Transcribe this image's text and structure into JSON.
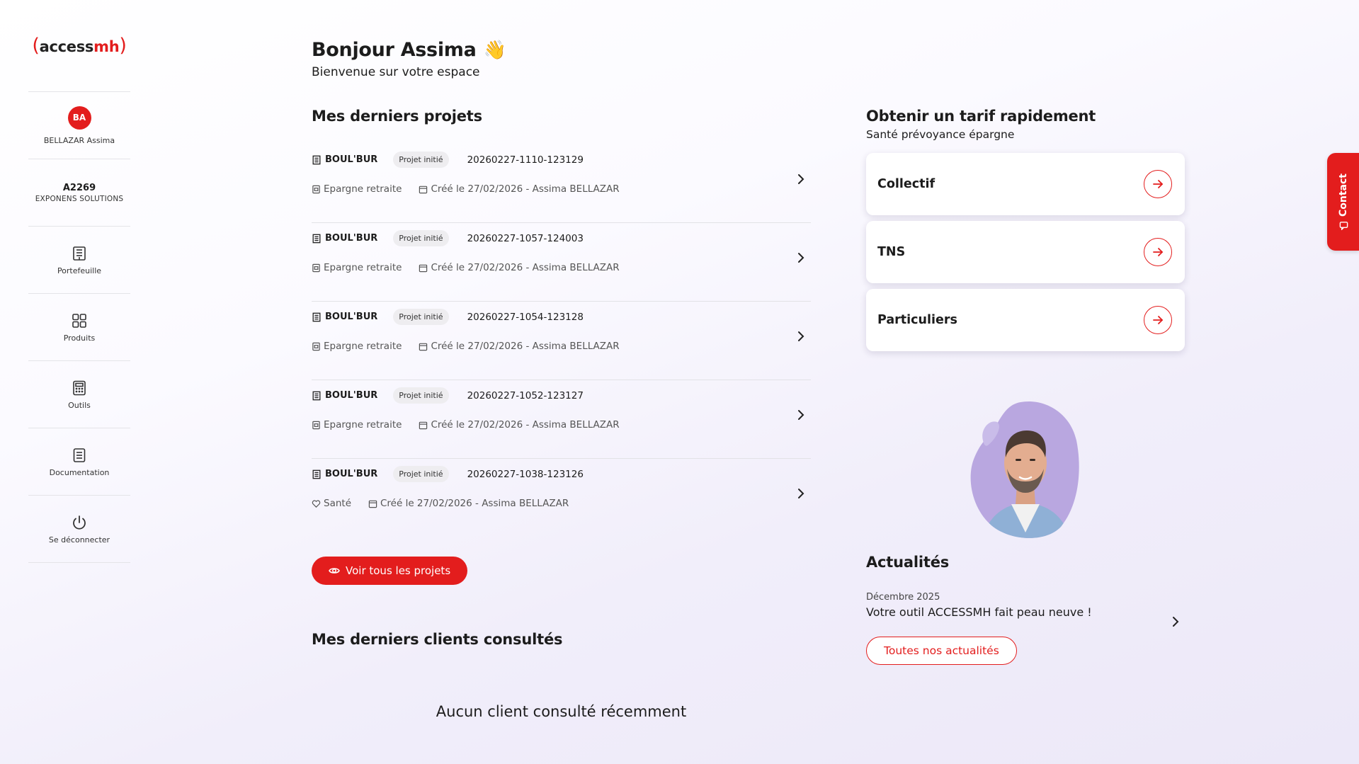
{
  "brand": {
    "logo_prefix": "(",
    "logo_main": "access",
    "logo_accent": "mh",
    "logo_suffix": ")",
    "accent_color": "#e31d1d"
  },
  "sidebar": {
    "user": {
      "initials": "BA",
      "name": "BELLAZAR Assima"
    },
    "agency": {
      "code": "A2269",
      "name": "EXPONENS SOLUTIONS"
    },
    "items": [
      {
        "label": "Portefeuille",
        "icon": "building-icon"
      },
      {
        "label": "Produits",
        "icon": "grid-icon"
      },
      {
        "label": "Outils",
        "icon": "calculator-icon"
      },
      {
        "label": "Documentation",
        "icon": "document-icon"
      },
      {
        "label": "Se déconnecter",
        "icon": "power-icon"
      }
    ]
  },
  "header": {
    "title": "Bonjour Assima",
    "subtitle": "Bienvenue sur votre espace",
    "emoji": "👋"
  },
  "projects": {
    "title": "Mes derniers projets",
    "items": [
      {
        "company": "BOUL'BUR",
        "status": "Projet initié",
        "ref": "20260227-1110-123129",
        "category": "Epargne retraite",
        "created": "Créé le 27/02/2026 - Assima BELLAZAR"
      },
      {
        "company": "BOUL'BUR",
        "status": "Projet initié",
        "ref": "20260227-1057-124003",
        "category": "Epargne retraite",
        "created": "Créé le 27/02/2026 - Assima BELLAZAR"
      },
      {
        "company": "BOUL'BUR",
        "status": "Projet initié",
        "ref": "20260227-1054-123128",
        "category": "Epargne retraite",
        "created": "Créé le 27/02/2026 - Assima BELLAZAR"
      },
      {
        "company": "BOUL'BUR",
        "status": "Projet initié",
        "ref": "20260227-1052-123127",
        "category": "Epargne retraite",
        "created": "Créé le 27/02/2026 - Assima BELLAZAR"
      },
      {
        "company": "BOUL'BUR",
        "status": "Projet initié",
        "ref": "20260227-1038-123126",
        "category": "Santé",
        "created": "Créé le 27/02/2026 - Assima BELLAZAR"
      }
    ],
    "view_all_label": "Voir tous les projets"
  },
  "clients": {
    "title": "Mes derniers clients consultés",
    "empty_message": "Aucun client consulté récemment"
  },
  "quote": {
    "title": "Obtenir un tarif rapidement",
    "subtitle": "Santé prévoyance épargne",
    "options": [
      "Collectif",
      "TNS",
      "Particuliers"
    ]
  },
  "news": {
    "title": "Actualités",
    "items": [
      {
        "date": "Décembre 2025",
        "headline": "Votre outil ACCESSMH fait peau neuve !"
      }
    ],
    "all_label": "Toutes nos actualités"
  },
  "contact_tab": {
    "label": "Contact"
  }
}
